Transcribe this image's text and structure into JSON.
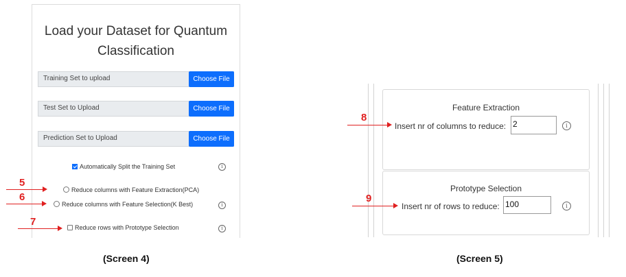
{
  "screen4": {
    "title": "Load your Dataset for Quantum Classification",
    "uploads": [
      {
        "label": "Training Set to upload",
        "button": "Choose File"
      },
      {
        "label": "Test Set to Upload",
        "button": "Choose File"
      },
      {
        "label": "Prediction Set to Upload",
        "button": "Choose File"
      }
    ],
    "options": {
      "auto_split": "Automatically Split the Training Set",
      "pca": "Reduce columns with Feature Extraction(PCA)",
      "kbest": "Reduce columns with Feature Selection(K Best)",
      "prototype": "Reduce rows with Prototype Selection"
    },
    "info_glyph": "i",
    "markers": [
      "5",
      "6",
      "7"
    ],
    "caption": "(Screen 4)"
  },
  "screen5": {
    "feature_extraction": {
      "heading": "Feature Extraction",
      "label": "Insert nr of columns to reduce:",
      "value": "2"
    },
    "prototype_selection": {
      "heading": "Prototype Selection",
      "label": "Insert nr of rows to reduce:",
      "value": "100"
    },
    "info_glyph": "i",
    "markers": [
      "8",
      "9"
    ],
    "caption": "(Screen 5)"
  },
  "colors": {
    "button_blue": "#0d6efd",
    "marker_red": "#e02020",
    "field_gray": "#e9ecef"
  }
}
